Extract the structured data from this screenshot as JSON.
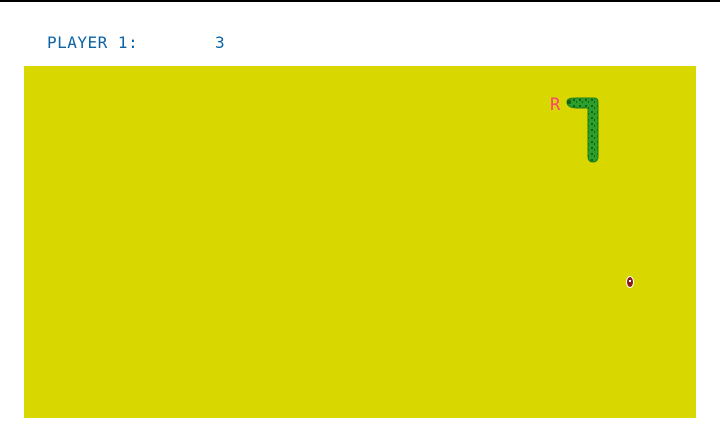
{
  "hud": {
    "player_label": "PLAYER 1:",
    "score": "3"
  },
  "game": {
    "snake_label": "R",
    "colors": {
      "playfield": "#d8d800",
      "snake_body": "#2b9e2b",
      "snake_texture": "#156315",
      "snake_label": "#ff3e79",
      "food": "#8b1a1a",
      "hud_text": "#0b63a6"
    },
    "icons": {
      "snake": "snake-icon",
      "food": "food-pellet-icon"
    }
  }
}
